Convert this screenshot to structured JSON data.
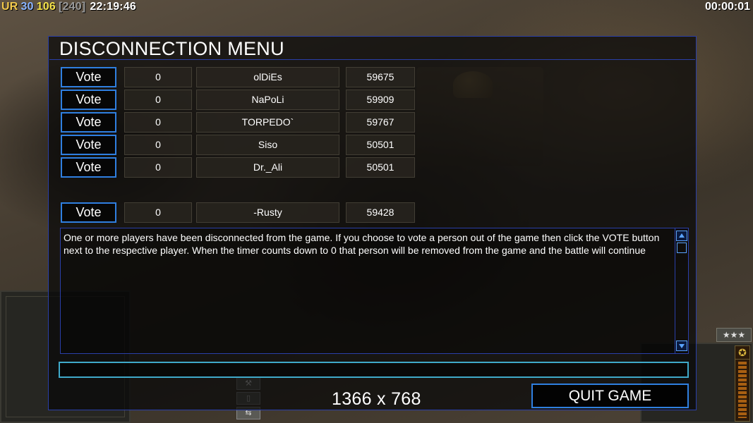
{
  "hud": {
    "label_ur": "UR",
    "val_30": "30",
    "val_106": "106",
    "val_240": "[240]",
    "clock": "22:19:46",
    "timer": "00:00:01"
  },
  "dialog": {
    "title": "DISCONNECTION MENU",
    "vote_label": "Vote",
    "players": [
      {
        "votes": "0",
        "name": "olDiEs",
        "ping": "59675"
      },
      {
        "votes": "0",
        "name": "NaPoLi",
        "ping": "59909"
      },
      {
        "votes": "0",
        "name": "TORPEDO`",
        "ping": "59767"
      },
      {
        "votes": "0",
        "name": "Siso",
        "ping": "50501"
      },
      {
        "votes": "0",
        "name": "Dr._Ali",
        "ping": "50501"
      }
    ],
    "local_player": {
      "votes": "0",
      "name": "-Rusty",
      "ping": "59428"
    },
    "message": "One or more players have been disconnected from the game. If you choose to vote a person out of the game then click the VOTE button next to the respective player. When the timer counts down to 0 that person will be removed from the game and the battle will continue",
    "chat_value": "",
    "quit_label": "QUIT GAME"
  },
  "overlay": {
    "resolution": "1366 x 768"
  },
  "icons": {
    "rank": "three-stars-icon",
    "power": "star-icon"
  },
  "colors": {
    "accent_blue": "#2f7fe0",
    "border_blue": "#2a3fa8",
    "chat_cyan": "#3fa9c9"
  }
}
